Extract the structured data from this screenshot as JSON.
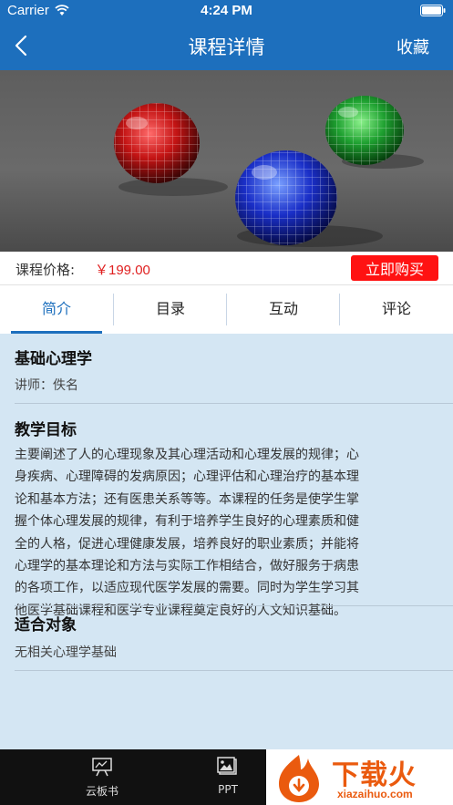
{
  "status_bar": {
    "carrier": "Carrier",
    "time": "4:24 PM"
  },
  "nav": {
    "title": "课程详情",
    "favorite_label": "收藏"
  },
  "banner": {
    "description_icon": "glass-spheres-image"
  },
  "price": {
    "label": "课程价格:",
    "value": "￥199.00",
    "buy_label": "立即购买"
  },
  "tabs": [
    {
      "label": "简介",
      "active": true
    },
    {
      "label": "目录",
      "active": false
    },
    {
      "label": "互动",
      "active": false
    },
    {
      "label": "评论",
      "active": false
    }
  ],
  "course": {
    "name": "基础心理学",
    "teacher": "讲师：佚名",
    "goal_title": "教学目标",
    "goal_lines": [
      "主要阐述了人的心理现象及其心理活动和心理发展的规律；心",
      "身疾病、心理障碍的发病原因；心理评估和心理治疗的基本理",
      "论和基本方法；还有医患关系等等。本课程的任务是使学生掌",
      "握个体心理发展的规律，有利于培养学生良好的心理素质和健",
      "全的人格，促进心理健康发展，培养良好的职业素质；并能将",
      "心理学的基本理论和方法与实际工作相结合，做好服务于病患",
      "的各项工作，以适应现代医学发展的需要。同时为学生学习其",
      "他医学基础课程和医学专业课程奠定良好的人文知识基础。"
    ],
    "audience_title": "适合对象",
    "audience": "无相关心理学基础"
  },
  "tabbar": [
    {
      "label": "云板书",
      "icon": "whiteboard-icon"
    },
    {
      "label": "PPT",
      "icon": "ppt-icon"
    }
  ],
  "watermark": {
    "text": "下载火",
    "url": "xiazaihuo.com"
  },
  "colors": {
    "primary": "#1d6fbd",
    "price": "#e02020",
    "buy_button": "#ff1212",
    "content_bg": "#d4e6f3"
  }
}
